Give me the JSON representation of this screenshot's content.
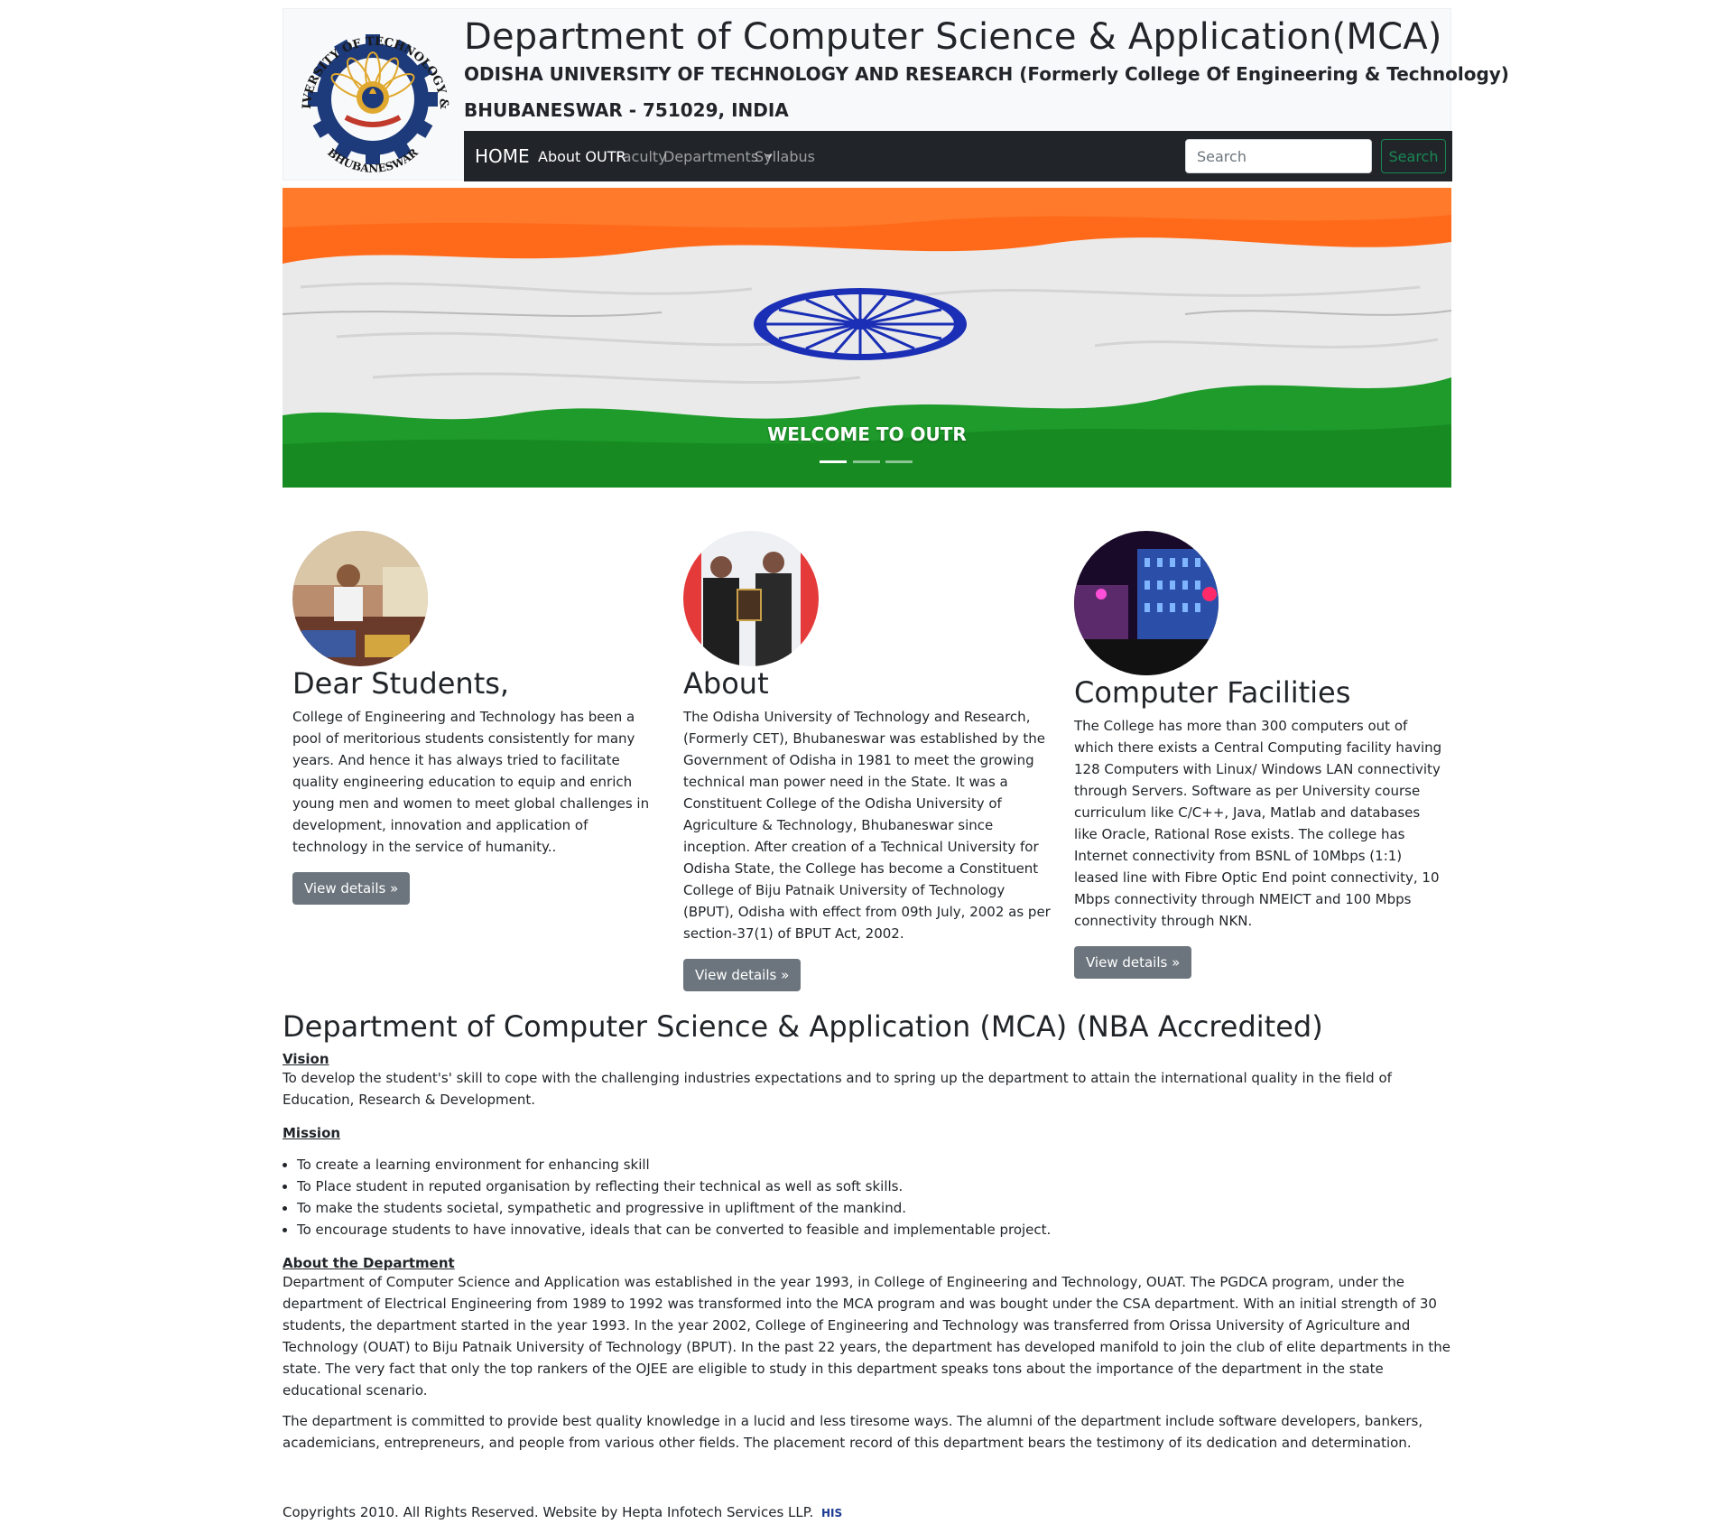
{
  "header": {
    "title": "Department of Computer Science & Application(MCA)",
    "university": "ODISHA UNIVERSITY OF TECHNOLOGY AND RESEARCH (Formerly College Of Engineering & Technology)",
    "city": "BHUBANESWAR - 751029, INDIA",
    "logo_text_top": "ODISHA UNIVERSITY OF TECHNOLOGY & RESEARCH",
    "logo_text_bottom": "BHUBANESWAR"
  },
  "navbar": {
    "brand": "HOME",
    "links": [
      "About OUTR",
      "Faculty",
      "Departments",
      "Syllabus"
    ],
    "search_placeholder": "Search",
    "search_button": "Search"
  },
  "carousel": {
    "caption": "WELCOME TO OUTR",
    "slide_count": 3,
    "active_slide": 1
  },
  "columns": [
    {
      "heading": "Dear Students,",
      "text": "College of Engineering and Technology has been a pool of meritorious students consistently for many years. And hence it has always tried to facilitate quality engineering education to equip and enrich young men and women to meet global challenges in development, innovation and application of technology in the service of humanity..",
      "button": "View details »"
    },
    {
      "heading": "About",
      "text": "The Odisha University of Technology and Research, (Formerly CET), Bhubaneswar was established by the Government of Odisha in 1981 to meet the growing technical man power need in the State. It was a Constituent College of the Odisha University of Agriculture & Technology, Bhubaneswar since inception. After creation of a Technical University for Odisha State, the College has become a Constituent College of Biju Patnaik University of Technology (BPUT), Odisha with effect from 09th July, 2002 as per section-37(1) of BPUT Act, 2002.",
      "button": "View details »"
    },
    {
      "heading": "Computer Facilities",
      "text": "The College has more than 300 computers out of which there exists a Central Computing facility having 128 Computers with Linux/ Windows LAN connectivity through Servers. Software as per University course curriculum like C/C++, Java, Matlab and databases like Oracle, Rational Rose exists. The college has Internet connectivity from BSNL of 10Mbps (1:1) leased line with Fibre Optic End point connectivity, 10 Mbps connectivity through NMEICT and 100 Mbps connectivity through NKN.",
      "button": "View details »"
    }
  ],
  "department": {
    "heading": "Department of Computer Science & Application (MCA) (NBA Accredited)",
    "vision_label": "Vision",
    "vision_text": "To develop the student's' skill to cope with the challenging industries expectations and to spring up the department to attain the international quality in the field of Education, Research & Development.",
    "mission_label": "Mission",
    "mission_items": [
      "To create a learning environment for enhancing skill",
      "To Place student in reputed organisation by reflecting their technical as well as soft skills.",
      "To make the students societal, sympathetic and progressive in upliftment of the mankind.",
      "To encourage students to have innovative, ideals that can be converted to feasible and implementable project."
    ],
    "about_label": "About the Department",
    "about_p1": "Department of Computer Science and Application was established in the year 1993, in College of Engineering and Technology, OUAT. The PGDCA program, under the department of Electrical Engineering from 1989 to 1992 was transformed into the MCA program and was bought under the CSA department. With an initial strength of 30 students, the department started in the year 1993. In the year 2002, College of Engineering and Technology was transferred from Orissa University of Agriculture and Technology (OUAT) to Biju Patnaik University of Technology (BPUT). In the past 22 years, the department has developed manifold to join the club of elite departments in the state. The very fact that only the top rankers of the OJEE are eligible to study in this department speaks tons about the importance of the department in the state educational scenario.",
    "about_p2": "The department is committed to provide best quality knowledge in a lucid and less tiresome ways. The alumni of the department include software developers, bankers, academicians, entrepreneurs, and people from various other fields. The placement record of this department bears the testimony of its dedication and determination."
  },
  "footer": {
    "text": "Copyrights 2010. All Rights Reserved. Website by Hepta Infotech Services LLP.",
    "badge": "HIS"
  },
  "colors": {
    "navbar_bg": "#212529",
    "header_bg": "#f8f9fa",
    "saffron": "#ff6a1a",
    "green": "#1e9b2a",
    "chakra_blue": "#1a2fb5",
    "button_secondary": "#6c757d",
    "search_green": "#198754"
  }
}
